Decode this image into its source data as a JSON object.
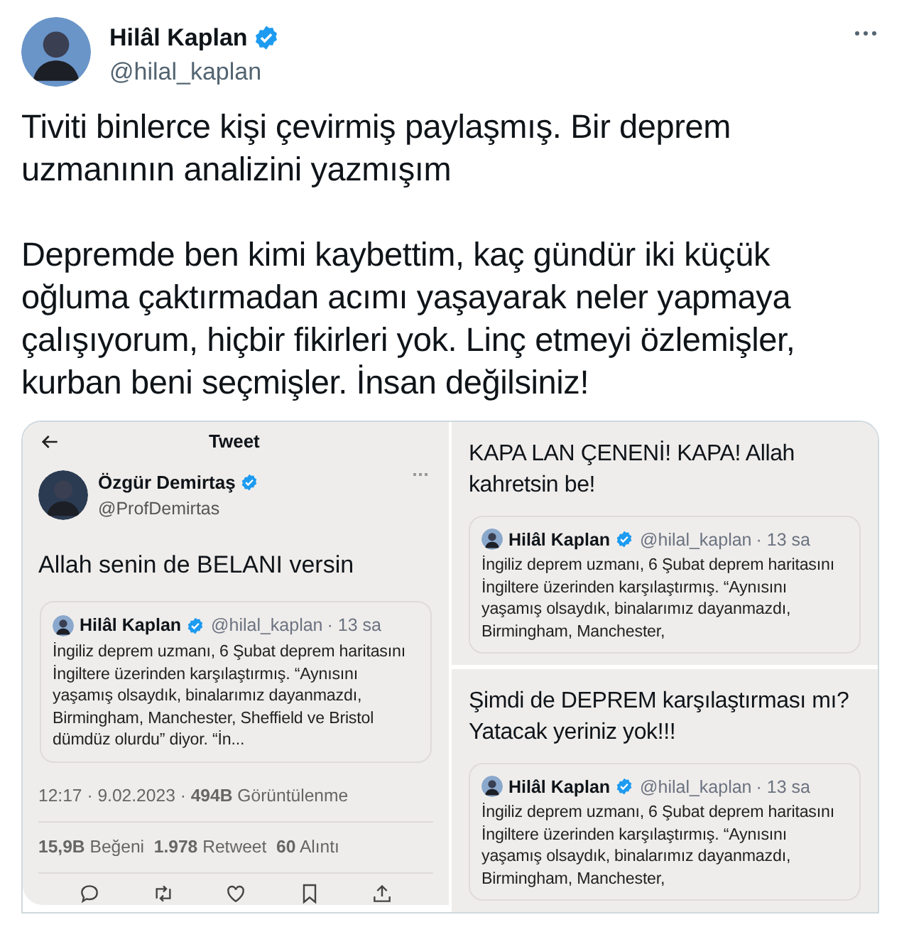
{
  "tweet": {
    "author": {
      "name": "Hilâl Kaplan",
      "handle": "@hilal_kaplan",
      "verified": true
    },
    "text": "Tiviti binlerce kişi çevirmiş paylaşmış. Bir deprem uzmanının analizini yazmışım\n\nDepremde ben kimi kaybettim, kaç gündür iki küçük oğluma çaktırmadan acımı yaşayarak neler yapmaya çalışıyorum, hiçbir fikirleri yok. Linç etmeyi özlemişler, kurban beni seçmişler. İnsan değilsiniz!"
  },
  "media": [
    {
      "kind": "detail",
      "header": "Tweet",
      "author": {
        "name": "Özgür Demirtaş",
        "handle": "@ProfDemirtas",
        "verified": true
      },
      "text": "Allah senin de BELANI versin",
      "quote": {
        "name": "Hilâl Kaplan",
        "handle": "@hilal_kaplan",
        "time": "· 13 sa",
        "verified": true,
        "text": "İngiliz deprem uzmanı, 6 Şubat deprem haritasını İngiltere üzerinden karşılaştırmış. “Aynısını yaşamış olsaydık, binalarımız dayanmazdı, Birmingham, Manchester, Sheffield ve Bristol dümdüz olurdu” diyor. “İn..."
      },
      "meta": "12:17 · 9.02.2023 · **494B** Görüntülenme",
      "stats": "**15,9B** Beğeni  **1.978** Retweet  **60** Alıntı"
    },
    {
      "kind": "reply",
      "text": "KAPA LAN ÇENENİ! KAPA! Allah kahretsin be!",
      "quote": {
        "name": "Hilâl Kaplan",
        "handle": "@hilal_kaplan",
        "time": "· 13 sa",
        "verified": true,
        "text": "İngiliz deprem uzmanı, 6 Şubat deprem haritasını İngiltere üzerinden karşılaştırmış. “Aynısını yaşamış olsaydık, binalarımız dayanmazdı, Birmingham, Manchester,"
      }
    },
    {
      "kind": "reply",
      "text": "Şimdi de DEPREM karşılaştırması mı? Yatacak yeriniz yok!!!",
      "quote": {
        "name": "Hilâl Kaplan",
        "handle": "@hilal_kaplan",
        "time": "· 13 sa",
        "verified": true,
        "text": "İngiliz deprem uzmanı, 6 Şubat deprem haritasını İngiltere üzerinden karşılaştırmış. “Aynısını yaşamış olsaydık, binalarımız dayanmazdı, Birmingham, Manchester,"
      }
    }
  ]
}
